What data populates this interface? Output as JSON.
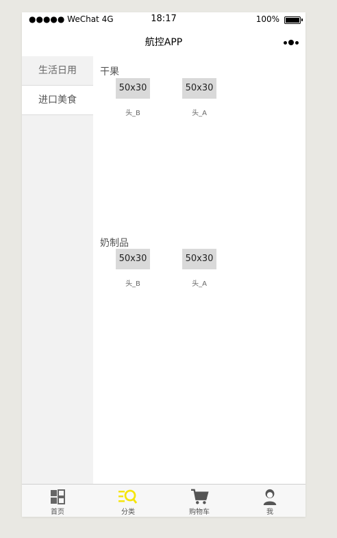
{
  "status_bar": {
    "carrier": "●●●●● WeChat 4G",
    "time": "18:17",
    "battery": "100%"
  },
  "nav": {
    "title": "航控APP"
  },
  "sidebar": {
    "items": [
      {
        "label": "生活日用",
        "active": false
      },
      {
        "label": "进口美食",
        "active": true
      }
    ]
  },
  "sections": [
    {
      "title": "干果",
      "products": [
        {
          "image_text": "50x30",
          "name": "头_B"
        },
        {
          "image_text": "50x30",
          "name": "头_A"
        }
      ]
    },
    {
      "title": "奶制品",
      "products": [
        {
          "image_text": "50x30",
          "name": "头_B"
        },
        {
          "image_text": "50x30",
          "name": "头_A"
        }
      ]
    }
  ],
  "tabbar": {
    "items": [
      {
        "label": "首页",
        "icon": "grid-icon",
        "active": false
      },
      {
        "label": "分类",
        "icon": "category-search-icon",
        "active": true
      },
      {
        "label": "购物车",
        "icon": "cart-icon",
        "active": false
      },
      {
        "label": "我",
        "icon": "user-icon",
        "active": false
      }
    ],
    "active_color": "#f5e50b",
    "inactive_color": "#666666"
  }
}
